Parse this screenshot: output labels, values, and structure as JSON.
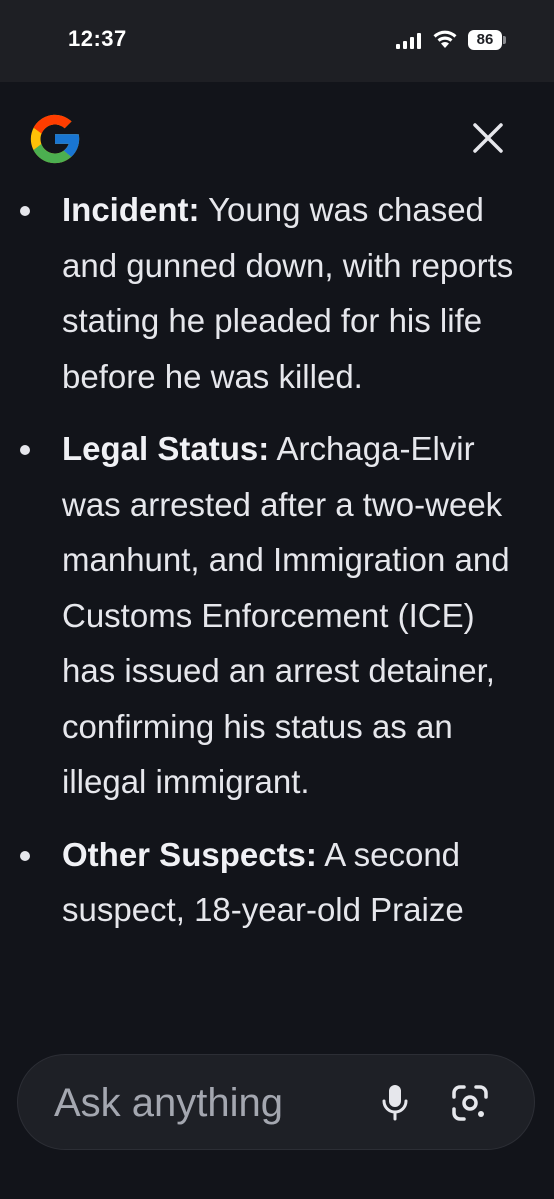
{
  "status_bar": {
    "time": "12:37",
    "battery_level": "86"
  },
  "header": {
    "logo_icon": "google-g-logo",
    "close_icon": "close-icon"
  },
  "items": [
    {
      "label": "Incident:",
      "text": " Young was chased and gunned down, with reports stating he pleaded for his life before he was killed."
    },
    {
      "label": "Legal Status:",
      "text": " Archaga-Elvir was arrested after a two-week manhunt, and Immigration and Customs Enforcement (ICE) has issued an arrest detainer, confirming his status as an illegal immigrant."
    },
    {
      "label": "Other Suspects:",
      "text": " A second suspect, 18-year-old Praize"
    }
  ],
  "input": {
    "placeholder": "Ask anything",
    "mic_icon": "microphone-icon",
    "lens_icon": "camera-lens-icon"
  },
  "colors": {
    "background": "#12141a",
    "status_bar": "#1e1f24",
    "text": "#e6e7ec",
    "input_bg": "#1e2026",
    "placeholder": "#a4a7b0"
  }
}
